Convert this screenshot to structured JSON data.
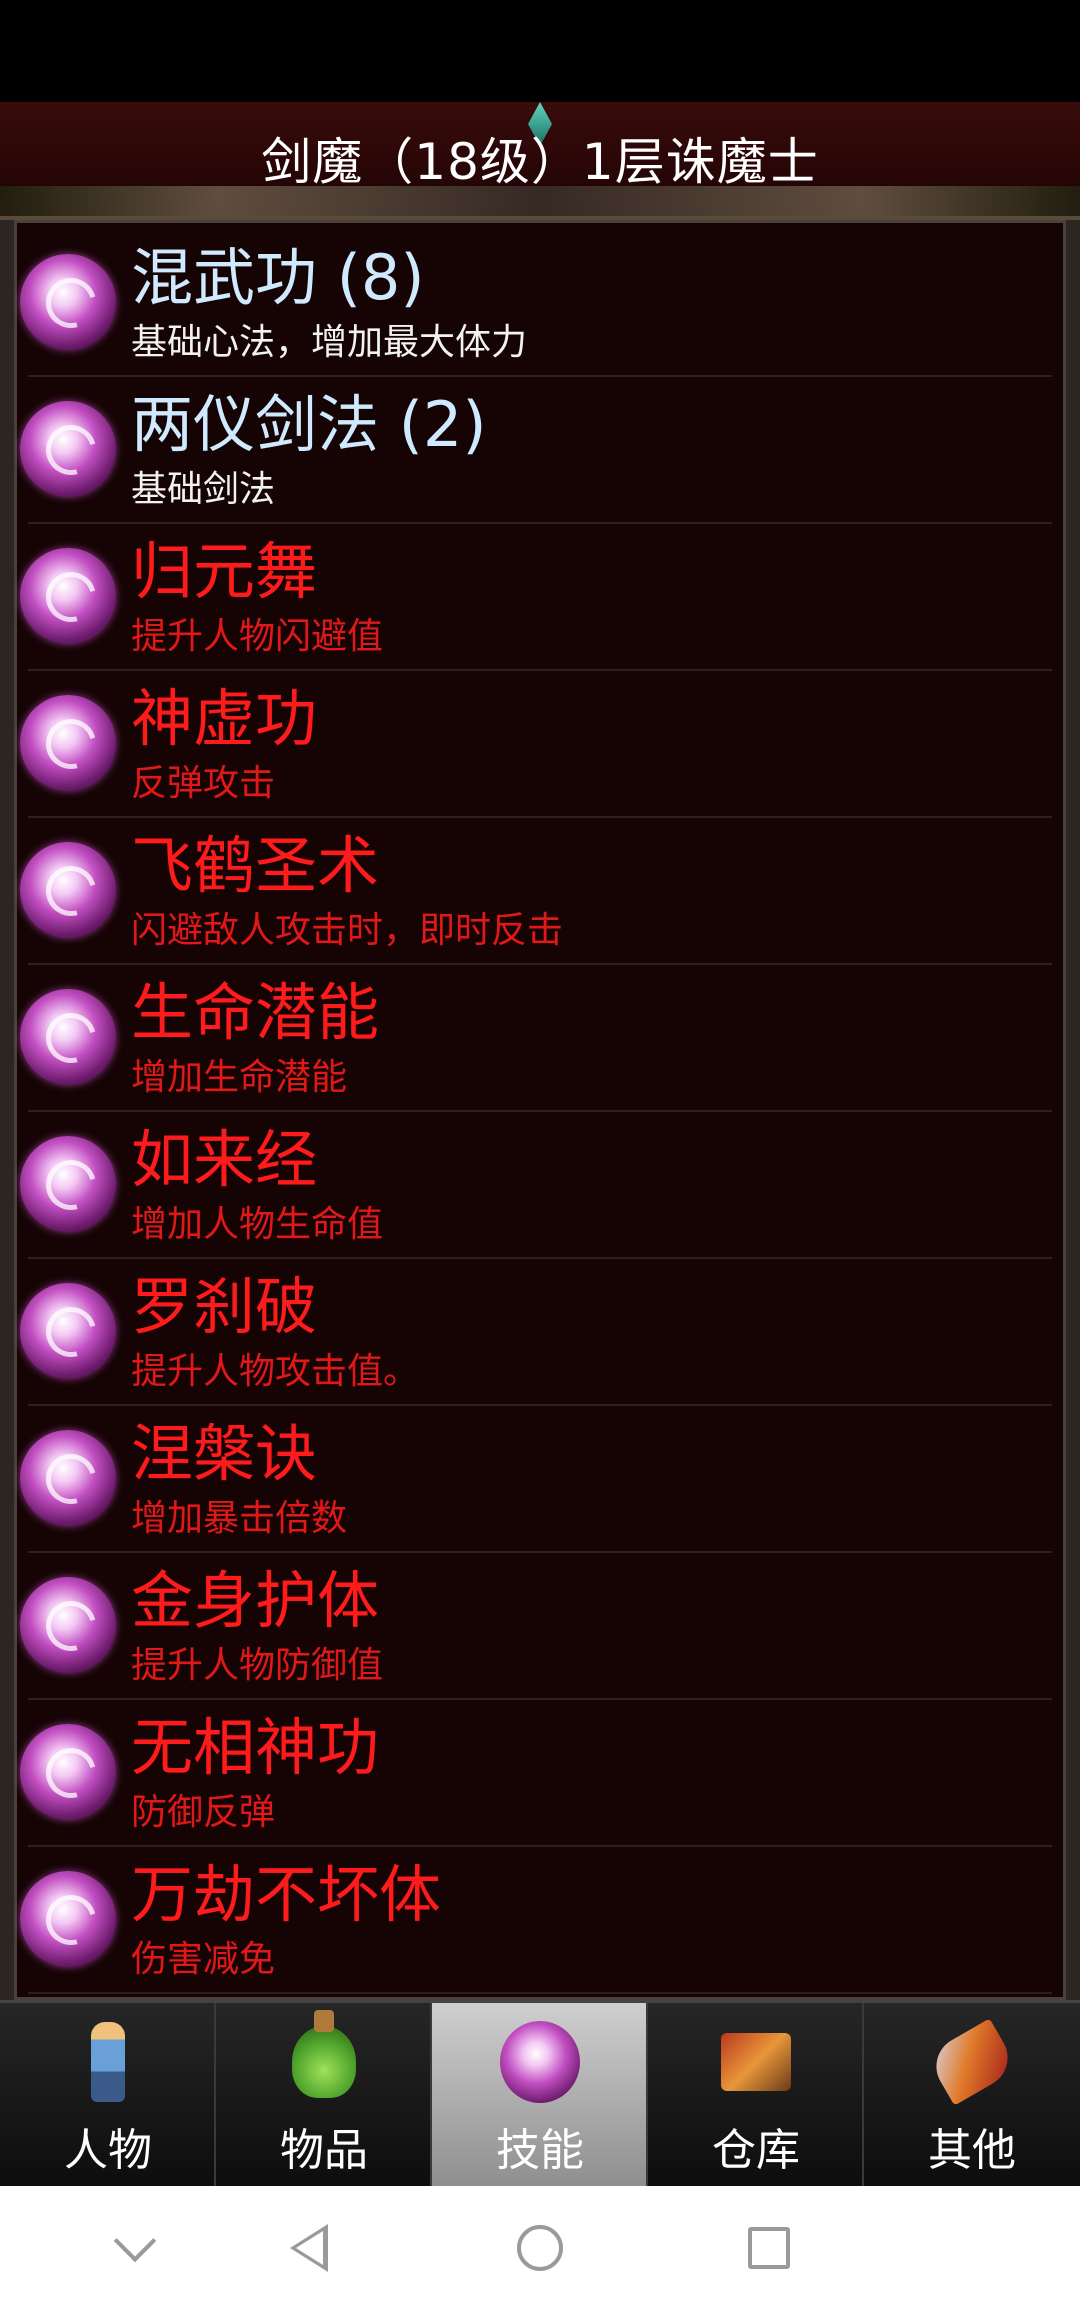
{
  "header": {
    "title": "剑魔（18级）1层诛魔士"
  },
  "skills": [
    {
      "name": "混武功 (8)",
      "desc": "基础心法，增加最大体力",
      "learned": true
    },
    {
      "name": "两仪剑法 (2)",
      "desc": "基础剑法",
      "learned": true
    },
    {
      "name": "归元舞",
      "desc": "提升人物闪避值",
      "learned": false
    },
    {
      "name": "神虚功",
      "desc": "反弹攻击",
      "learned": false
    },
    {
      "name": "飞鹤圣术",
      "desc": "闪避敌人攻击时，即时反击",
      "learned": false
    },
    {
      "name": "生命潜能",
      "desc": "增加生命潜能",
      "learned": false
    },
    {
      "name": "如来经",
      "desc": "增加人物生命值",
      "learned": false
    },
    {
      "name": "罗刹破",
      "desc": "提升人物攻击值。",
      "learned": false
    },
    {
      "name": "涅槃诀",
      "desc": "增加暴击倍数",
      "learned": false
    },
    {
      "name": "金身护体",
      "desc": "提升人物防御值",
      "learned": false
    },
    {
      "name": "无相神功",
      "desc": "防御反弹",
      "learned": false
    },
    {
      "name": "万劫不坏体",
      "desc": "伤害减免",
      "learned": false
    }
  ],
  "tabs": [
    {
      "label": "人物",
      "icon": "character-icon",
      "active": false
    },
    {
      "label": "物品",
      "icon": "potion-icon",
      "active": false
    },
    {
      "label": "技能",
      "icon": "skill-orb-icon",
      "active": true
    },
    {
      "label": "仓库",
      "icon": "warehouse-icon",
      "active": false
    },
    {
      "label": "其他",
      "icon": "sword-icon",
      "active": false
    }
  ],
  "colors": {
    "learned_name": "#cfe9ff",
    "locked_name": "#ff1b1b",
    "background": "#160405"
  }
}
